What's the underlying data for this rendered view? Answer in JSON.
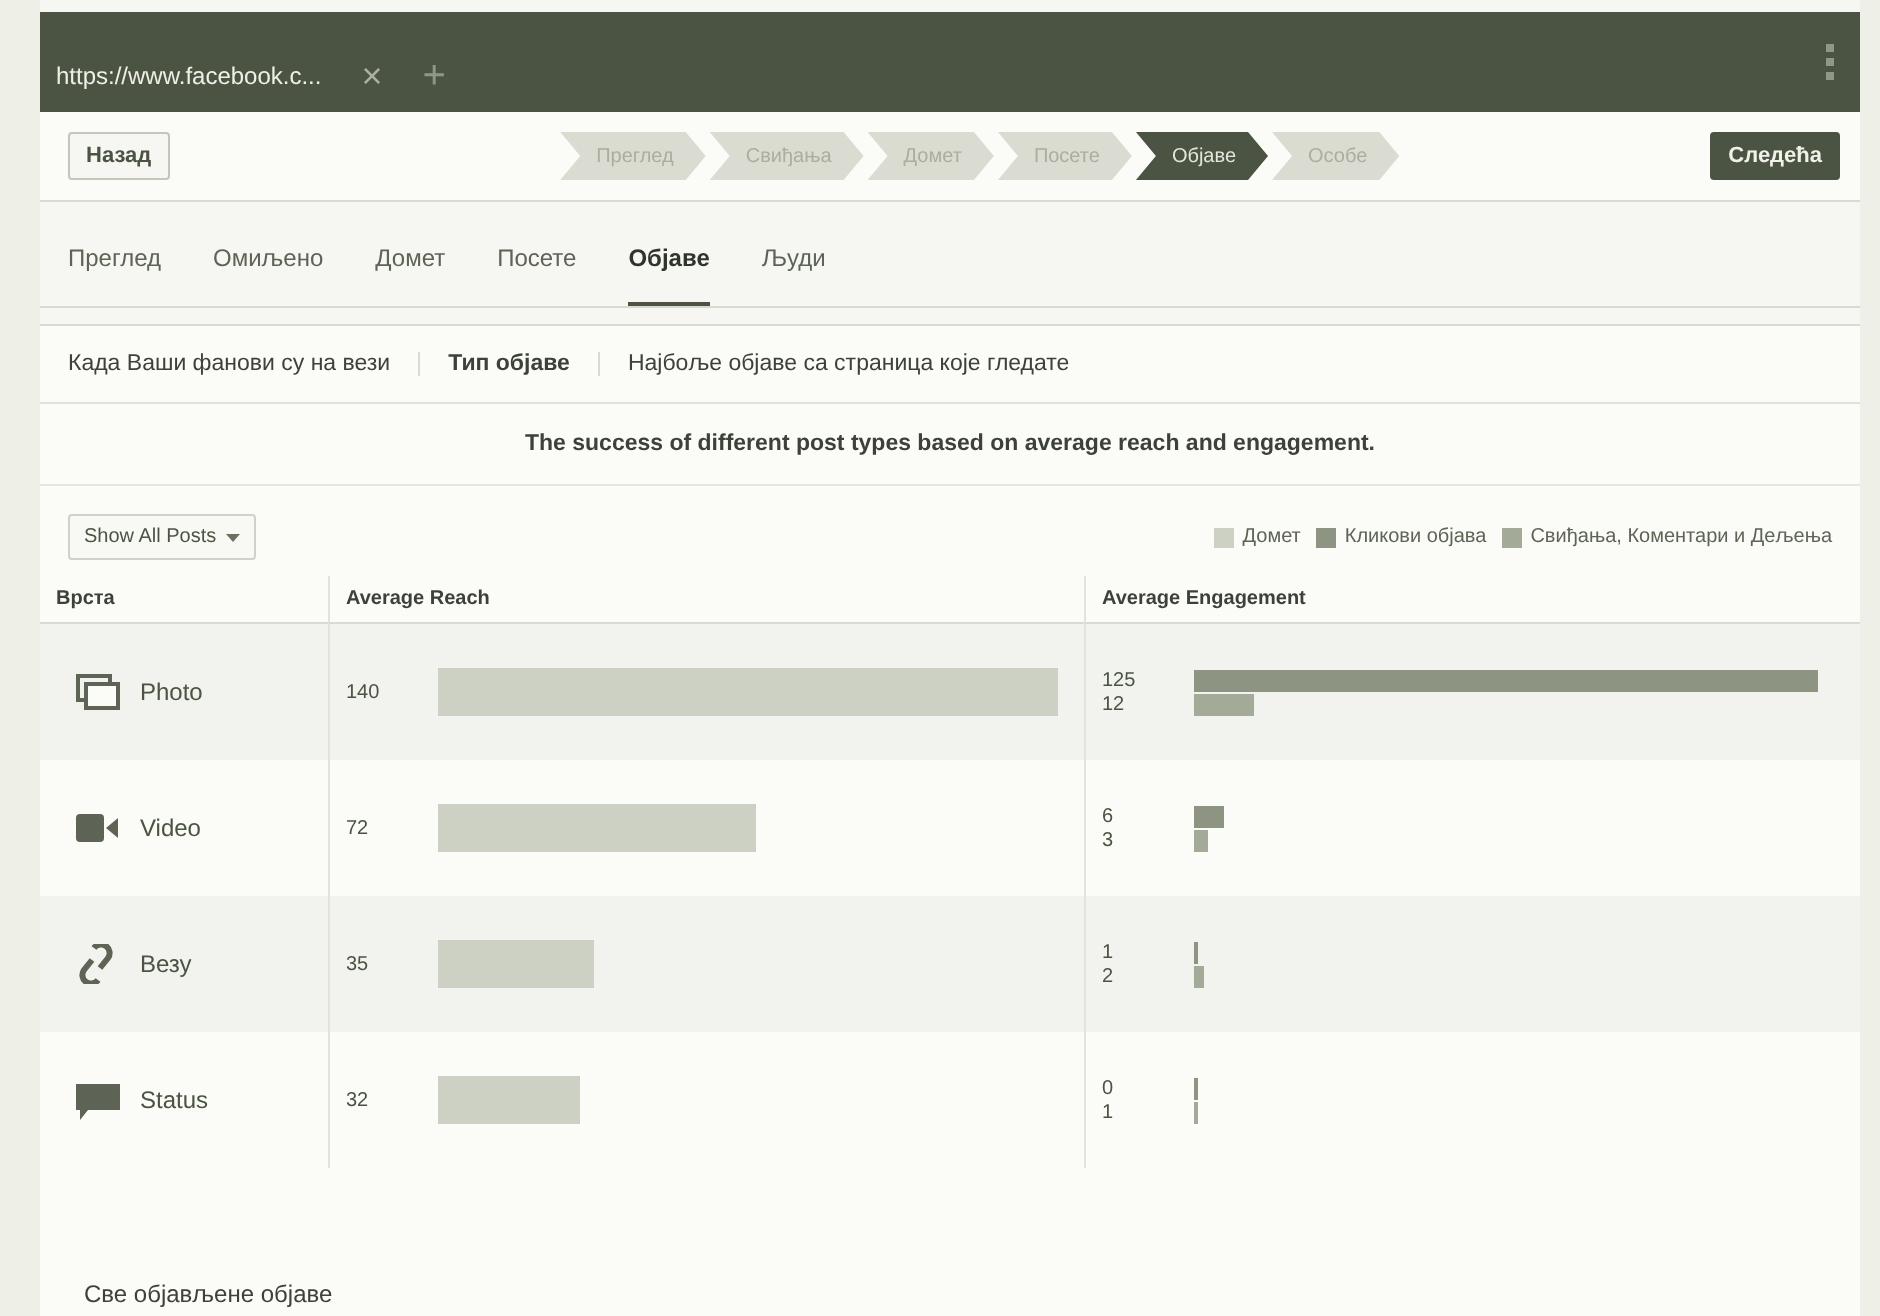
{
  "browser_tab": {
    "title": "https://www.facebook.c...",
    "close": "×",
    "new_tab": "+"
  },
  "wizard": {
    "back": "Назад",
    "next": "Следећа",
    "steps": [
      {
        "label": "Преглед",
        "selected": false
      },
      {
        "label": "Свиђања",
        "selected": false
      },
      {
        "label": "Домет",
        "selected": false
      },
      {
        "label": "Посете",
        "selected": false
      },
      {
        "label": "Објаве",
        "selected": true
      },
      {
        "label": "Особе",
        "selected": false
      }
    ]
  },
  "tabs": [
    {
      "label": "Преглед",
      "selected": false
    },
    {
      "label": "Омиљено",
      "selected": false
    },
    {
      "label": "Домет",
      "selected": false
    },
    {
      "label": "Посете",
      "selected": false
    },
    {
      "label": "Објаве",
      "selected": true
    },
    {
      "label": "Људи",
      "selected": false
    }
  ],
  "subtabs": [
    {
      "label": "Када Ваши фанови су на вези",
      "selected": false
    },
    {
      "label": "Тип објаве",
      "selected": true
    },
    {
      "label": "Најбоље објаве са страница које гледате",
      "selected": false
    }
  ],
  "description": "The success of different post types based on average reach and engagement.",
  "filter": {
    "label": "Show All Posts"
  },
  "legend": [
    {
      "label": "Домет",
      "color": "#cdd1c4"
    },
    {
      "label": "Кликови објава",
      "color": "#8d9582"
    },
    {
      "label": "Свиђања, Коментари и Дељења",
      "color": "#a3aa97"
    }
  ],
  "table": {
    "columns": [
      "Врста",
      "Average Reach",
      "Average Engagement"
    ],
    "rows": [
      {
        "kind": "photo",
        "label": "Photo",
        "reach": {
          "value": "140"
        },
        "engagement": [
          {
            "value": "125"
          },
          {
            "value": "12"
          }
        ]
      },
      {
        "kind": "video",
        "label": "Video",
        "reach": {
          "value": "72"
        },
        "engagement": [
          {
            "value": "6"
          },
          {
            "value": "3"
          }
        ]
      },
      {
        "kind": "link",
        "label": "Везу",
        "reach": {
          "value": "35"
        },
        "engagement": [
          {
            "value": "1"
          },
          {
            "value": "2"
          }
        ]
      },
      {
        "kind": "status",
        "label": "Status",
        "reach": {
          "value": "32"
        },
        "engagement": [
          {
            "value": "0"
          },
          {
            "value": "1"
          }
        ]
      }
    ]
  },
  "footer_link": "Све објављене објаве"
}
